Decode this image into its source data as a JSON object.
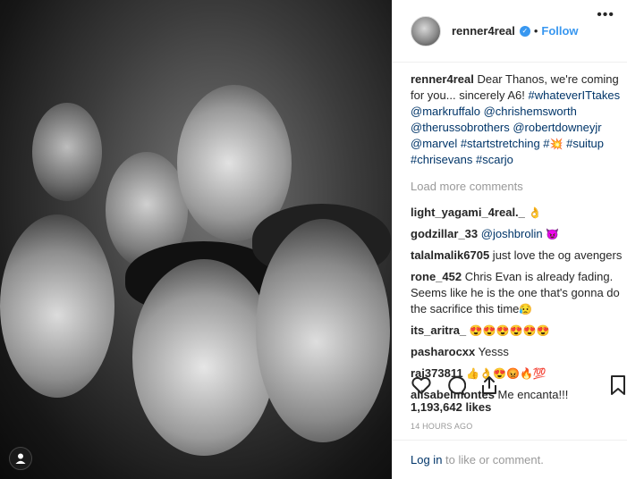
{
  "post": {
    "username": "renner4real",
    "separator": "•",
    "follow_label": "Follow",
    "caption": {
      "user": "renner4real",
      "text_1": "Dear Thanos, we're coming for you... sincerely A6! ",
      "tags_1": "#whateverITtakes @markruffalo @chrishemsworth @therussobrothers @robertdowneyjr @marvel #startstretching #",
      "emoji_1": "💥",
      "tags_2": " #suitup #chrisevans #scarjo"
    },
    "load_more": "Load more comments",
    "comments": [
      {
        "user": "light_yagami_4real._",
        "text": "",
        "emoji": "👌"
      },
      {
        "user": "godzillar_33",
        "text": "",
        "link": "@joshbrolin",
        "emoji": " 😈"
      },
      {
        "user": "talalmalik6705",
        "text": " just love the og avengers",
        "emoji": ""
      },
      {
        "user": "rone_452",
        "text": " Chris Evan is already fading. Seems like he is the one that's gonna do the sacrifice this time",
        "emoji": "😥"
      },
      {
        "user": "its_aritra_",
        "text": " ",
        "emoji": "😍😍😍😍😍😍"
      },
      {
        "user": "pasharocxx",
        "text": " Yesss",
        "emoji": ""
      },
      {
        "user": "raj373811",
        "text": " ",
        "emoji": "👍👌😍😡🔥💯"
      },
      {
        "user": "alisabelmontes",
        "text": " Me encanta!!!",
        "emoji": ""
      }
    ],
    "likes": "1,193,642 likes",
    "time": "14 HOURS AGO",
    "login": {
      "link": "Log in",
      "rest": " to like or comment."
    },
    "more": "•••"
  },
  "icons": {
    "heart": "heart-icon",
    "comment": "comment-icon",
    "share": "share-icon",
    "bookmark": "bookmark-icon",
    "verified": "verified-badge-icon",
    "user": "user-tag-icon"
  },
  "colors": {
    "link_blue": "#3897f0",
    "link_dark": "#003569",
    "muted": "#999999",
    "text": "#262626"
  }
}
